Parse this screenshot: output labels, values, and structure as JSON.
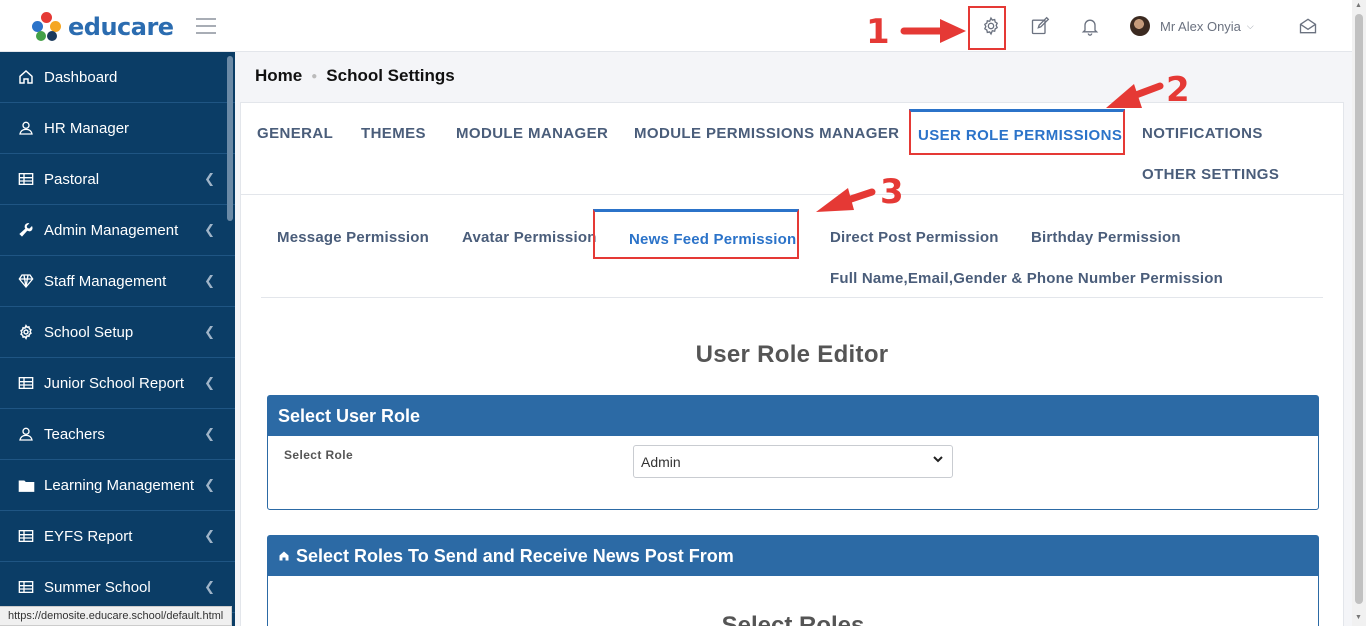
{
  "app": {
    "logo_text": "educare"
  },
  "header": {
    "user_name": "Mr Alex Onyia",
    "icons": [
      "settings-gear-icon",
      "edit-icon",
      "bell-icon",
      "mail-open-icon"
    ]
  },
  "annotations": {
    "n1": "1",
    "n2": "2",
    "n3": "3",
    "color": "#e53935"
  },
  "sidebar": {
    "items": [
      {
        "label": "Dashboard",
        "icon": "home-icon",
        "has_chevron": false
      },
      {
        "label": "HR Manager",
        "icon": "user-icon",
        "has_chevron": false
      },
      {
        "label": "Pastoral",
        "icon": "table-icon",
        "has_chevron": true
      },
      {
        "label": "Admin Management",
        "icon": "wrench-icon",
        "has_chevron": true
      },
      {
        "label": "Staff Management",
        "icon": "diamond-icon",
        "has_chevron": true
      },
      {
        "label": "School Setup",
        "icon": "gear-icon",
        "has_chevron": true
      },
      {
        "label": "Junior School Report",
        "icon": "table-icon",
        "has_chevron": true
      },
      {
        "label": "Teachers",
        "icon": "user-icon",
        "has_chevron": true
      },
      {
        "label": "Learning Management",
        "icon": "folder-icon",
        "has_chevron": true
      },
      {
        "label": "EYFS Report",
        "icon": "table-icon",
        "has_chevron": true
      },
      {
        "label": "Summer School",
        "icon": "table-icon",
        "has_chevron": true
      }
    ]
  },
  "breadcrumb": {
    "home": "Home",
    "current": "School Settings"
  },
  "main_tabs": [
    {
      "label": "GENERAL"
    },
    {
      "label": "THEMES"
    },
    {
      "label": "MODULE MANAGER"
    },
    {
      "label": "MODULE PERMISSIONS MANAGER"
    },
    {
      "label": "USER ROLE PERMISSIONS",
      "active": true
    },
    {
      "label": "NOTIFICATIONS"
    },
    {
      "label": "OTHER SETTINGS"
    }
  ],
  "sub_tabs": [
    {
      "label": "Message Permission"
    },
    {
      "label": "Avatar Permission"
    },
    {
      "label": "News Feed Permission",
      "active": true
    },
    {
      "label": "Direct Post Permission"
    },
    {
      "label": "Birthday Permission"
    },
    {
      "label": "Full Name,Email,Gender & Phone Number Permission"
    }
  ],
  "editor": {
    "title": "User Role Editor",
    "panel1_title": "Select User Role",
    "select_label": "Select Role",
    "select_value": "Admin",
    "panel2_title": "Select Roles To Send and Receive News Post From",
    "panel2_subtitle": "Select Roles"
  },
  "status_bar": {
    "url": "https://demosite.educare.school/default.html"
  },
  "colors": {
    "sidebar": "#0b3d66",
    "accent": "#2b73c9",
    "panel": "#2c6aa5",
    "highlight": "#e53935"
  }
}
